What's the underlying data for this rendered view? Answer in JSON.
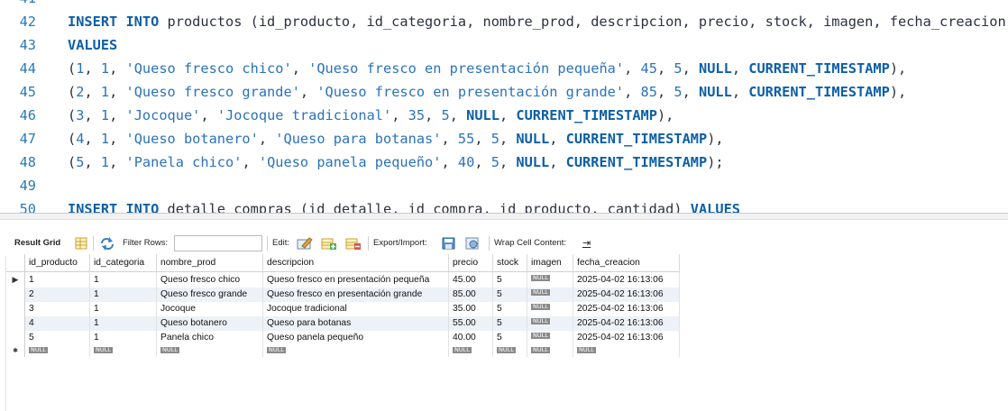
{
  "editor": {
    "lines": [
      {
        "n": "41",
        "tokens": []
      },
      {
        "n": "42",
        "tokens": [
          {
            "t": "kw",
            "v": "INSERT INTO"
          },
          {
            "t": "pl",
            "v": " productos (id_producto, id_categoria, nombre_prod, descripcion, precio, stock, imagen, fecha_creacion)"
          }
        ]
      },
      {
        "n": "43",
        "tokens": [
          {
            "t": "kw",
            "v": "VALUES"
          }
        ]
      },
      {
        "n": "44",
        "tokens": [
          {
            "t": "pl",
            "v": "("
          },
          {
            "t": "num",
            "v": "1"
          },
          {
            "t": "pl",
            "v": ", "
          },
          {
            "t": "num",
            "v": "1"
          },
          {
            "t": "pl",
            "v": ", "
          },
          {
            "t": "str",
            "v": "'Queso fresco chico'"
          },
          {
            "t": "pl",
            "v": ", "
          },
          {
            "t": "str",
            "v": "'Queso fresco en presentación pequeña'"
          },
          {
            "t": "pl",
            "v": ", "
          },
          {
            "t": "num",
            "v": "45"
          },
          {
            "t": "pl",
            "v": ", "
          },
          {
            "t": "num",
            "v": "5"
          },
          {
            "t": "pl",
            "v": ", "
          },
          {
            "t": "kw",
            "v": "NULL"
          },
          {
            "t": "pl",
            "v": ", "
          },
          {
            "t": "kw",
            "v": "CURRENT_TIMESTAMP"
          },
          {
            "t": "pl",
            "v": "),"
          }
        ]
      },
      {
        "n": "45",
        "tokens": [
          {
            "t": "pl",
            "v": "("
          },
          {
            "t": "num",
            "v": "2"
          },
          {
            "t": "pl",
            "v": ", "
          },
          {
            "t": "num",
            "v": "1"
          },
          {
            "t": "pl",
            "v": ", "
          },
          {
            "t": "str",
            "v": "'Queso fresco grande'"
          },
          {
            "t": "pl",
            "v": ", "
          },
          {
            "t": "str",
            "v": "'Queso fresco en presentación grande'"
          },
          {
            "t": "pl",
            "v": ", "
          },
          {
            "t": "num",
            "v": "85"
          },
          {
            "t": "pl",
            "v": ", "
          },
          {
            "t": "num",
            "v": "5"
          },
          {
            "t": "pl",
            "v": ", "
          },
          {
            "t": "kw",
            "v": "NULL"
          },
          {
            "t": "pl",
            "v": ", "
          },
          {
            "t": "kw",
            "v": "CURRENT_TIMESTAMP"
          },
          {
            "t": "pl",
            "v": "),"
          }
        ]
      },
      {
        "n": "46",
        "tokens": [
          {
            "t": "pl",
            "v": "("
          },
          {
            "t": "num",
            "v": "3"
          },
          {
            "t": "pl",
            "v": ", "
          },
          {
            "t": "num",
            "v": "1"
          },
          {
            "t": "pl",
            "v": ", "
          },
          {
            "t": "str",
            "v": "'Jocoque'"
          },
          {
            "t": "pl",
            "v": ", "
          },
          {
            "t": "str",
            "v": "'Jocoque tradicional'"
          },
          {
            "t": "pl",
            "v": ", "
          },
          {
            "t": "num",
            "v": "35"
          },
          {
            "t": "pl",
            "v": ", "
          },
          {
            "t": "num",
            "v": "5"
          },
          {
            "t": "pl",
            "v": ", "
          },
          {
            "t": "kw",
            "v": "NULL"
          },
          {
            "t": "pl",
            "v": ", "
          },
          {
            "t": "kw",
            "v": "CURRENT_TIMESTAMP"
          },
          {
            "t": "pl",
            "v": "),"
          }
        ]
      },
      {
        "n": "47",
        "tokens": [
          {
            "t": "pl",
            "v": "("
          },
          {
            "t": "num",
            "v": "4"
          },
          {
            "t": "pl",
            "v": ", "
          },
          {
            "t": "num",
            "v": "1"
          },
          {
            "t": "pl",
            "v": ", "
          },
          {
            "t": "str",
            "v": "'Queso botanero'"
          },
          {
            "t": "pl",
            "v": ", "
          },
          {
            "t": "str",
            "v": "'Queso para botanas'"
          },
          {
            "t": "pl",
            "v": ", "
          },
          {
            "t": "num",
            "v": "55"
          },
          {
            "t": "pl",
            "v": ", "
          },
          {
            "t": "num",
            "v": "5"
          },
          {
            "t": "pl",
            "v": ", "
          },
          {
            "t": "kw",
            "v": "NULL"
          },
          {
            "t": "pl",
            "v": ", "
          },
          {
            "t": "kw",
            "v": "CURRENT_TIMESTAMP"
          },
          {
            "t": "pl",
            "v": "),"
          }
        ]
      },
      {
        "n": "48",
        "tokens": [
          {
            "t": "pl",
            "v": "("
          },
          {
            "t": "num",
            "v": "5"
          },
          {
            "t": "pl",
            "v": ", "
          },
          {
            "t": "num",
            "v": "1"
          },
          {
            "t": "pl",
            "v": ", "
          },
          {
            "t": "str",
            "v": "'Panela chico'"
          },
          {
            "t": "pl",
            "v": ", "
          },
          {
            "t": "str",
            "v": "'Queso panela pequeño'"
          },
          {
            "t": "pl",
            "v": ", "
          },
          {
            "t": "num",
            "v": "40"
          },
          {
            "t": "pl",
            "v": ", "
          },
          {
            "t": "num",
            "v": "5"
          },
          {
            "t": "pl",
            "v": ", "
          },
          {
            "t": "kw",
            "v": "NULL"
          },
          {
            "t": "pl",
            "v": ", "
          },
          {
            "t": "kw",
            "v": "CURRENT_TIMESTAMP"
          },
          {
            "t": "pl",
            "v": ");"
          }
        ]
      },
      {
        "n": "49",
        "tokens": []
      },
      {
        "n": "50",
        "tokens": [
          {
            "t": "kw",
            "v": "INSERT INTO"
          },
          {
            "t": "pl",
            "v": " detalle_compras (id_detalle, id_compra, id_producto, cantidad) "
          },
          {
            "t": "kw",
            "v": "VALUES"
          }
        ]
      }
    ]
  },
  "toolbar": {
    "result_grid": "Result Grid",
    "filter_rows": "Filter Rows:",
    "filter_value": "",
    "edit": "Edit:",
    "export_import": "Export/Import:",
    "wrap_cell": "Wrap Cell Content:",
    "wrap_icon_glyph": "⇥"
  },
  "grid": {
    "columns": [
      "id_producto",
      "id_categoria",
      "nombre_prod",
      "descripcion",
      "precio",
      "stock",
      "imagen",
      "fecha_creacion"
    ],
    "rows": [
      [
        "1",
        "1",
        "Queso fresco chico",
        "Queso fresco en presentación pequeña",
        "45.00",
        "5",
        "NULL",
        "2025-04-02 16:13:06"
      ],
      [
        "2",
        "1",
        "Queso fresco grande",
        "Queso fresco en presentación grande",
        "85.00",
        "5",
        "NULL",
        "2025-04-02 16:13:06"
      ],
      [
        "3",
        "1",
        "Jocoque",
        "Jocoque tradicional",
        "35.00",
        "5",
        "NULL",
        "2025-04-02 16:13:06"
      ],
      [
        "4",
        "1",
        "Queso botanero",
        "Queso para botanas",
        "55.00",
        "5",
        "NULL",
        "2025-04-02 16:13:06"
      ],
      [
        "5",
        "1",
        "Panela chico",
        "Queso panela pequeño",
        "40.00",
        "5",
        "NULL",
        "2025-04-02 16:13:06"
      ]
    ],
    "new_row": [
      "NULL",
      "NULL",
      "NULL",
      "NULL",
      "NULL",
      "NULL",
      "NULL",
      "NULL"
    ],
    "current_row_marker": "▶",
    "new_row_marker": "✱"
  }
}
